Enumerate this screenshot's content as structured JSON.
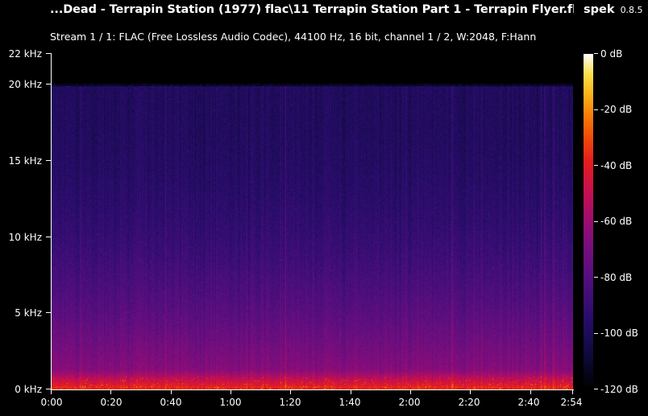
{
  "window": {
    "title": "...Dead - Terrapin Station (1977) flac\\11 Terrapin Station Part 1 - Terrapin Flyer.flac",
    "app_name": "spek",
    "app_version": "0.8.5",
    "stream_info": "Stream 1 / 1: FLAC (Free Lossless Audio Codec), 44100 Hz, 16 bit, channel 1 / 2, W:2048, F:Hann"
  },
  "y_axis": {
    "ticks": [
      "22 kHz",
      "20 kHz",
      "15 kHz",
      "10 kHz",
      "5 kHz",
      "0 kHz"
    ]
  },
  "x_axis": {
    "ticks": [
      "0:00",
      "0:20",
      "0:40",
      "1:00",
      "1:20",
      "1:40",
      "2:00",
      "2:20",
      "2:40",
      "2:54"
    ]
  },
  "colorbar": {
    "ticks": [
      "0 dB",
      "-20 dB",
      "-40 dB",
      "-60 dB",
      "-80 dB",
      "-100 dB",
      "-120 dB"
    ]
  },
  "colors": {
    "background": "#000000",
    "text": "#ffffff"
  }
}
